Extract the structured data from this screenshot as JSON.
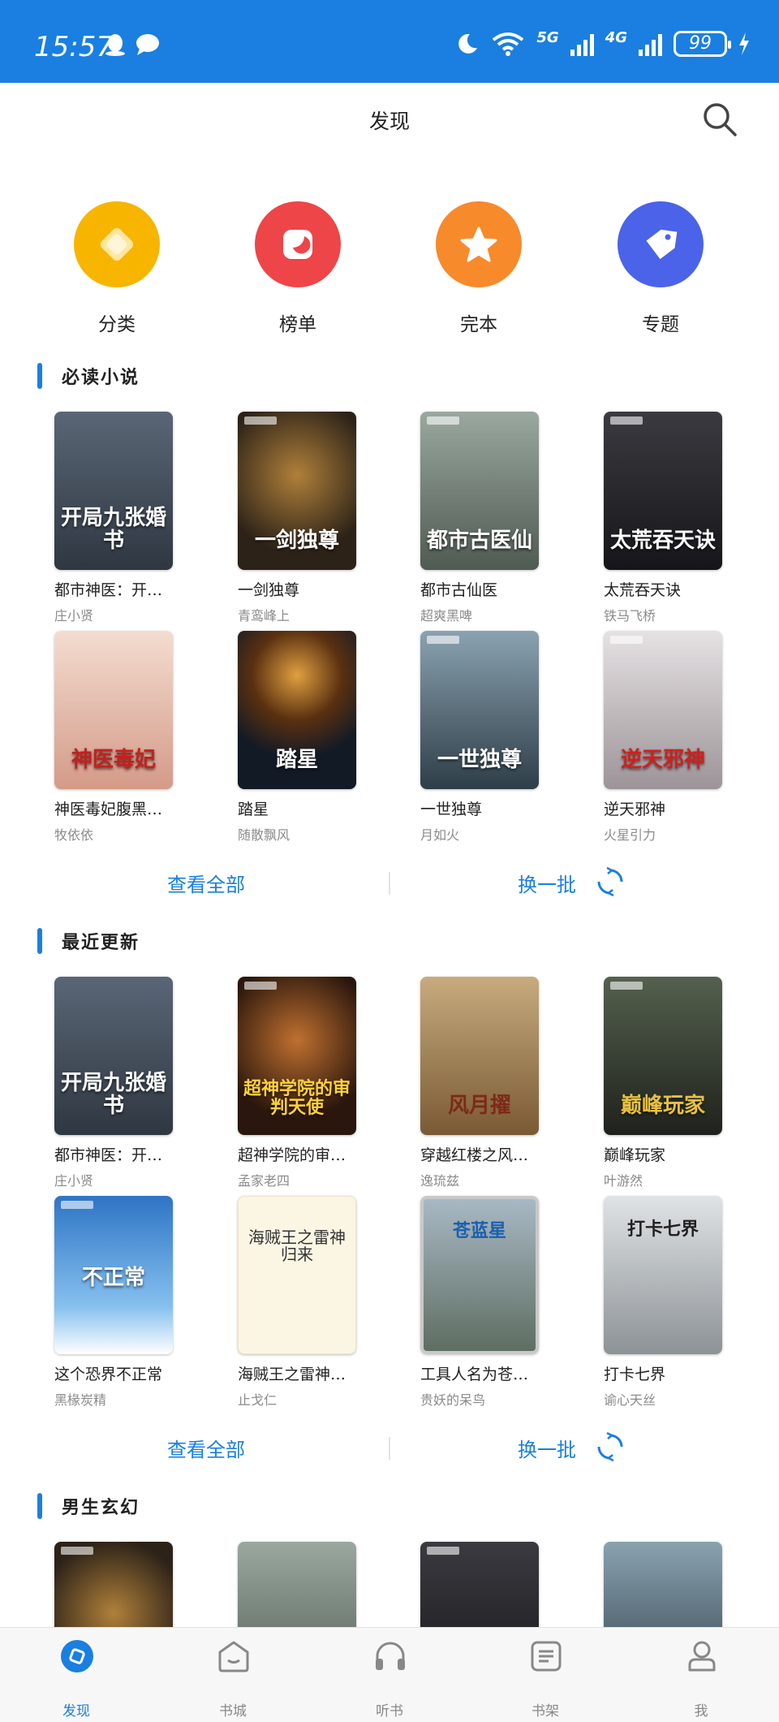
{
  "status": {
    "time": "15:57",
    "net1": "5G",
    "net2": "4G",
    "battery": "99"
  },
  "header": {
    "title": "发现"
  },
  "shortcuts": [
    {
      "label": "分类",
      "icon": "diamond-icon",
      "color": "#f7b500"
    },
    {
      "label": "榜单",
      "icon": "moon-badge-icon",
      "color": "#ee4548"
    },
    {
      "label": "完本",
      "icon": "star-icon",
      "color": "#f78a2b"
    },
    {
      "label": "专题",
      "icon": "tag-icon",
      "color": "#4a63e8"
    }
  ],
  "sections": [
    {
      "title": "必读小说",
      "books": [
        {
          "title": "都市神医：开…",
          "author": "庄小贤",
          "cover_text": "开局九张婚书",
          "cover_color": "#44505e"
        },
        {
          "title": "一剑独尊",
          "author": "青鸾峰上",
          "cover_text": "一剑独尊",
          "cover_color": "#2c2218"
        },
        {
          "title": "都市古仙医",
          "author": "超爽黑啤",
          "cover_text": "都市古医仙",
          "cover_color": "#6d7a6e"
        },
        {
          "title": "太荒吞天诀",
          "author": "铁马飞桥",
          "cover_text": "太荒吞天诀",
          "cover_color": "#2a2a2e"
        },
        {
          "title": "神医毒妃腹黑…",
          "author": "牧依依",
          "cover_text": "神医毒妃",
          "cover_color": "#e8c8b8"
        },
        {
          "title": "踏星",
          "author": "随散飘风",
          "cover_text": "踏星",
          "cover_color": "#1c2a3a"
        },
        {
          "title": "一世独尊",
          "author": "月如火",
          "cover_text": "一世独尊",
          "cover_color": "#4f6b7e"
        },
        {
          "title": "逆天邪神",
          "author": "火星引力",
          "cover_text": "逆天邪神",
          "cover_color": "#c9c5c8"
        }
      ],
      "view_all": "查看全部",
      "refresh": "换一批"
    },
    {
      "title": "最近更新",
      "books": [
        {
          "title": "都市神医：开…",
          "author": "庄小贤",
          "cover_text": "开局九张婚书",
          "cover_color": "#44505e"
        },
        {
          "title": "超神学院的审…",
          "author": "孟家老四",
          "cover_text": "超神学院的审判天使",
          "cover_color": "#3a2418"
        },
        {
          "title": "穿越红楼之风…",
          "author": "逸琉兹",
          "cover_text": "风月擢",
          "cover_color": "#a88a5e"
        },
        {
          "title": "巅峰玩家",
          "author": "叶游然",
          "cover_text": "巅峰玩家",
          "cover_color": "#3e4438"
        },
        {
          "title": "这个恐界不正常",
          "author": "黑椽炭精",
          "cover_text": "不正常",
          "cover_color": "#3a86d0"
        },
        {
          "title": "海贼王之雷神…",
          "author": "止戈仁",
          "cover_text": "海贼王之雷神归来",
          "cover_color": "#faf6e3"
        },
        {
          "title": "工具人名为苍…",
          "author": "贵妖的呆鸟",
          "cover_text": "苍蓝星",
          "cover_color": "#8ea0a8"
        },
        {
          "title": "打卡七界",
          "author": "谕心天丝",
          "cover_text": "打卡七界",
          "cover_color": "#b8bcbf"
        }
      ],
      "view_all": "查看全部",
      "refresh": "换一批"
    },
    {
      "title": "男生玄幻",
      "books": [
        {
          "cover_color": "#2c2218"
        },
        {
          "cover_color": "#6d7a6e"
        },
        {
          "cover_color": "#2a2a2e"
        },
        {
          "cover_color": "#4f6b7e"
        }
      ]
    }
  ],
  "bottom_nav": [
    {
      "label": "发现",
      "icon": "discover-icon",
      "active": true
    },
    {
      "label": "书城",
      "icon": "bookstore-icon",
      "active": false
    },
    {
      "label": "听书",
      "icon": "headphones-icon",
      "active": false
    },
    {
      "label": "书架",
      "icon": "bookshelf-icon",
      "active": false
    },
    {
      "label": "我",
      "icon": "profile-icon",
      "active": false
    }
  ],
  "colors": {
    "accent": "#1a7fe0",
    "status_bar": "#1a7fe0"
  }
}
